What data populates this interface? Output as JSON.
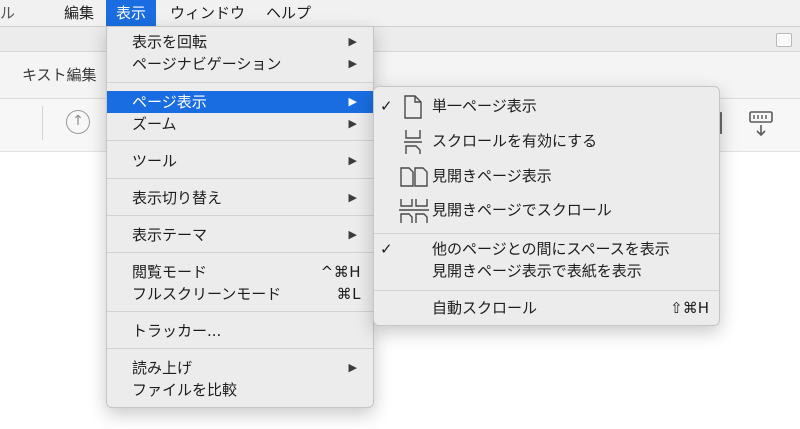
{
  "menubar": {
    "cut_item": "ル",
    "items": [
      "編集",
      "表示",
      "ウィンドウ",
      "ヘルプ"
    ],
    "active_index": 1
  },
  "window": {
    "title": "キスト編集"
  },
  "view_menu": {
    "items": [
      {
        "label": "表示を回転",
        "submenu": true
      },
      {
        "label": "ページナビゲーション",
        "submenu": true
      },
      {
        "label": "ページ表示",
        "submenu": true,
        "highlighted": true
      },
      {
        "label": "ズーム",
        "submenu": true
      },
      {
        "label": "ツール",
        "submenu": true
      },
      {
        "label": "表示切り替え",
        "submenu": true
      },
      {
        "label": "表示テーマ",
        "submenu": true
      },
      {
        "label": "閲覧モード",
        "shortcut": "^⌘H"
      },
      {
        "label": "フルスクリーンモード",
        "shortcut": "⌘L"
      },
      {
        "label": "トラッカー..."
      },
      {
        "label": "読み上げ",
        "submenu": true
      },
      {
        "label": "ファイルを比較"
      }
    ]
  },
  "page_display_submenu": {
    "items": [
      {
        "label": "単一ページ表示",
        "checked": true,
        "icon": "single-page-icon"
      },
      {
        "label": "スクロールを有効にする",
        "checked": false,
        "icon": "scroll-pages-icon"
      },
      {
        "label": "見開きページ表示",
        "checked": false,
        "icon": "two-page-icon"
      },
      {
        "label": "見開きページでスクロール",
        "checked": false,
        "icon": "two-page-scroll-icon"
      },
      {
        "label": "他のページとの間にスペースを表示",
        "checked": true
      },
      {
        "label": "見開きページ表示で表紙を表示",
        "checked": false
      },
      {
        "label": "自動スクロール",
        "shortcut": "⇧⌘H"
      }
    ],
    "check_glyph": "✓"
  },
  "glyphs": {
    "submenu_arrow": "▶",
    "up_arrow": "↑"
  },
  "colors": {
    "highlight": "#1a6de0",
    "menu_bg": "#ececec"
  }
}
